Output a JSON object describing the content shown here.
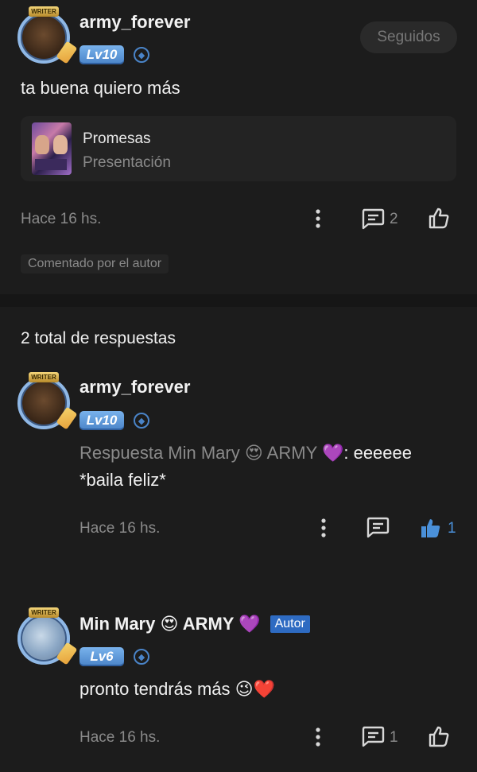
{
  "comment": {
    "username": "army_forever",
    "level": "Lv10",
    "follow_label": "Seguidos",
    "text": "ta buena quiero más",
    "linked_post": {
      "title": "Promesas",
      "subtitle": "Presentación"
    },
    "time": "Hace 16 hs.",
    "reply_count": "2",
    "author_tag": "Comentado por el autor"
  },
  "replies_header": "2 total de respuestas",
  "replies": [
    {
      "username": "army_forever",
      "level": "Lv10",
      "text_prefix": "Respuesta Min Mary 😍 ARMY 💜",
      "text_body": ": eeeeee",
      "text_line2": "*baila feliz*",
      "time": "Hace 16 hs.",
      "like_count": "1"
    },
    {
      "username": "Min Mary 😍 ARMY 💜",
      "author_badge": "Autor",
      "level": "Lv6",
      "text": "pronto tendrás más 😉❤️",
      "time": "Hace 16 hs.",
      "reply_count": "1"
    }
  ],
  "colors": {
    "background": "#1c1c1c",
    "level_badge": "#4a84c8",
    "liked": "#4a90d9",
    "author_badge": "#2e6bc2",
    "muted_text": "#8a8a8a"
  }
}
